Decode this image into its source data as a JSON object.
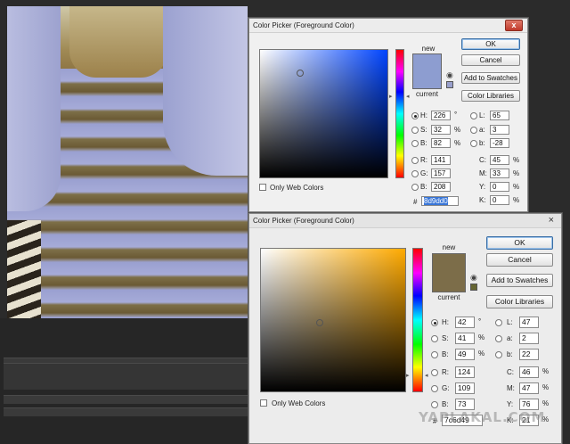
{
  "colors": {
    "dialog1_new": "#8d9dd0",
    "dialog1_current": "#8d9dd0",
    "dialog1_field_hue": "#0044ff",
    "dialog2_new": "#7c6d49",
    "dialog2_current": "#7c6d49",
    "dialog2_field_hue": "#ffaa00",
    "hex_highlight": "#3875d7"
  },
  "dialog1": {
    "title": "Color Picker (Foreground Color)",
    "close_label": "x",
    "new_label": "new",
    "current_label": "current",
    "buttons": {
      "ok": "OK",
      "cancel": "Cancel",
      "add_to_swatches": "Add to Swatches",
      "color_libraries": "Color Libraries"
    },
    "hsb": {
      "h": "226",
      "s": "32",
      "b": "82"
    },
    "rgb": {
      "r": "141",
      "g": "157",
      "b": "208"
    },
    "lab": {
      "l": "65",
      "a": "3",
      "b": "-28"
    },
    "cmyk": {
      "c": "45",
      "m": "33",
      "y": "0",
      "k": "0"
    },
    "hex_value": "8d9dd0",
    "only_web_colors": "Only Web Colors",
    "labels": {
      "h": "H:",
      "s": "S:",
      "b": "B:",
      "r": "R:",
      "g": "G:",
      "b2": "B:",
      "l": "L:",
      "a": "a:",
      "b3": "b:",
      "c": "C:",
      "m": "M:",
      "y": "Y:",
      "k": "K:",
      "hash": "#"
    },
    "units": {
      "deg": "°",
      "pct": "%"
    }
  },
  "dialog2": {
    "title": "Color Picker (Foreground Color)",
    "close_label": "×",
    "new_label": "new",
    "current_label": "current",
    "buttons": {
      "ok": "OK",
      "cancel": "Cancel",
      "add_to_swatches": "Add to Swatches",
      "color_libraries": "Color Libraries"
    },
    "hsb": {
      "h": "42",
      "s": "41",
      "b": "49"
    },
    "rgb": {
      "r": "124",
      "g": "109",
      "b": "73"
    },
    "lab": {
      "l": "47",
      "a": "2",
      "b": "22"
    },
    "cmyk": {
      "c": "46",
      "m": "47",
      "y": "76",
      "k": "21"
    },
    "hex_value": "7c6d49",
    "only_web_colors": "Only Web Colors",
    "labels": {
      "h": "H:",
      "s": "S:",
      "b": "B:",
      "r": "R:",
      "g": "G:",
      "b2": "B:",
      "l": "L:",
      "a": "a:",
      "b3": "b:",
      "c": "C:",
      "m": "M:",
      "y": "Y:",
      "k": "K:",
      "hash": "#"
    },
    "units": {
      "deg": "°",
      "pct": "%"
    }
  },
  "watermark": "YAPLAKAL.COM"
}
